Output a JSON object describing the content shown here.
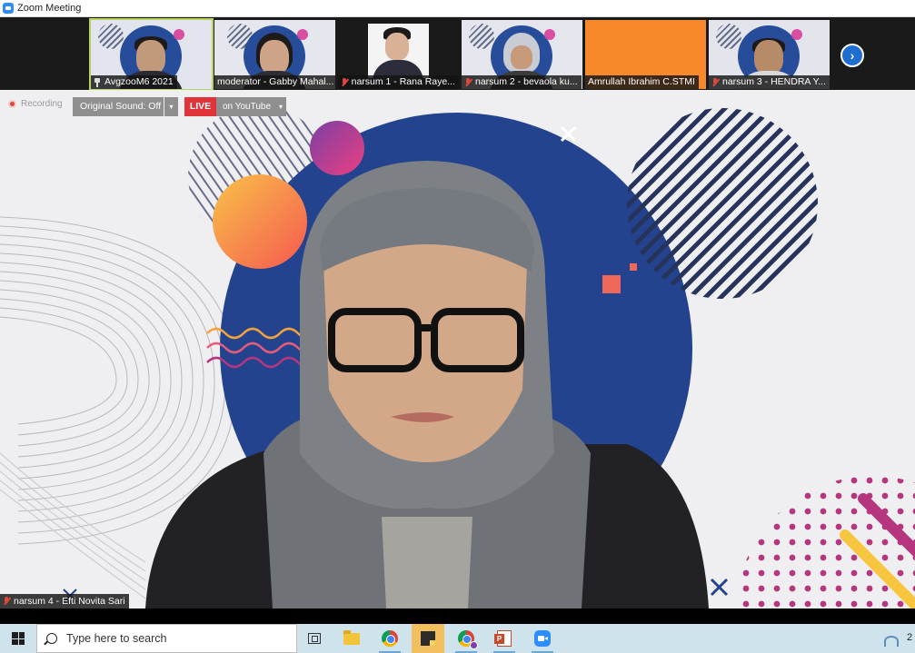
{
  "window": {
    "title": "Zoom Meeting"
  },
  "thumbnails": [
    {
      "name": "AvgzooM6 2021",
      "icon": "pin-icon",
      "type": "video-man"
    },
    {
      "name": "moderator - Gabby Mahal...",
      "icon": "",
      "type": "video-woman"
    },
    {
      "name": "narsum 1 - Rana Raye...",
      "icon": "mic-off-icon",
      "type": "video-white"
    },
    {
      "name": "narsum 2 - bevaola ku...",
      "icon": "mic-off-icon",
      "type": "video-hijab"
    },
    {
      "name": "Amrullah Ibrahim C.STMI",
      "icon": "",
      "type": "orange"
    },
    {
      "name": "narsum 3 - HENDRA Y...",
      "icon": "mic-off-icon",
      "type": "video-man2"
    }
  ],
  "next_page_label": "›",
  "controls": {
    "recording": "Recording",
    "original_sound": "Original Sound: Off",
    "original_caret": "▾",
    "live_badge": "LIVE",
    "youtube": "on YouTube",
    "youtube_caret": "▾"
  },
  "active_speaker": {
    "name": "narsum 4 - Efti Novita Sari"
  },
  "taskbar": {
    "search_placeholder": "Type here to search",
    "clock": "2"
  },
  "colors": {
    "accent_blue": "#2d8cff",
    "backdrop_navy": "#23438f",
    "live_red": "#e0343a",
    "magenta": "#b5367f",
    "taskbar": "#cfe3ec"
  }
}
